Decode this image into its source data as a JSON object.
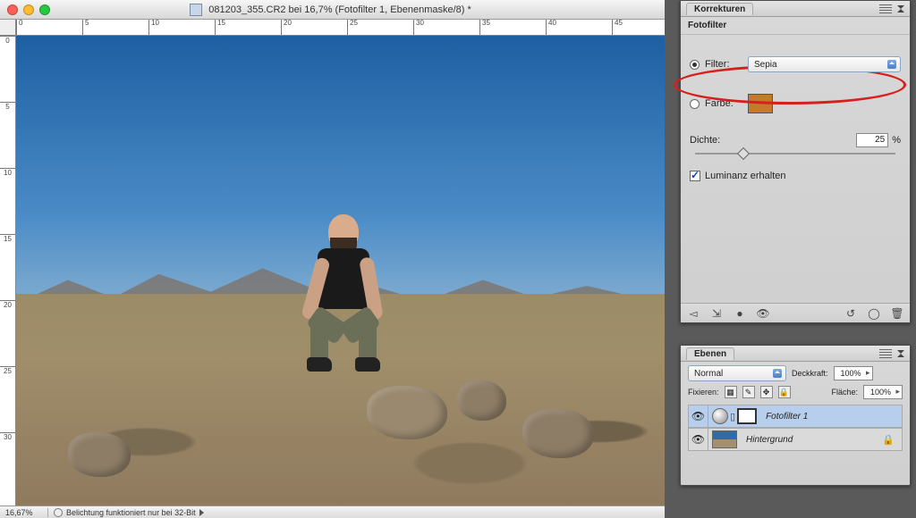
{
  "window": {
    "title": "081203_355.CR2 bei 16,7% (Fotofilter 1, Ebenenmaske/8) *"
  },
  "status": {
    "zoom": "16,67%",
    "info": "Belichtung funktioniert nur bei 32-Bit"
  },
  "ruler_h": [
    "0",
    "5",
    "10",
    "15",
    "20",
    "25",
    "30",
    "35",
    "40",
    "45"
  ],
  "ruler_v": [
    "0",
    "5",
    "10",
    "15",
    "20",
    "25",
    "30"
  ],
  "korrekturen": {
    "panel_title": "Korrekturen",
    "subtitle": "Fotofilter",
    "filter_label": "Filter:",
    "filter_value": "Sepia",
    "farbe_label": "Farbe:",
    "farbe_swatch": "#c47a2a",
    "dichte_label": "Dichte:",
    "dichte_value": "25",
    "dichte_pct": "%",
    "luminanz_label": "Luminanz erhalten",
    "mode": "filter"
  },
  "ebenen": {
    "panel_title": "Ebenen",
    "blend_mode": "Normal",
    "deckkraft_label": "Deckkraft:",
    "deckkraft_value": "100%",
    "fixieren_label": "Fixieren:",
    "flaeche_label": "Fläche:",
    "flaeche_value": "100%",
    "layers": [
      {
        "name": "Fotofilter 1",
        "type": "adjustment",
        "active": true
      },
      {
        "name": "Hintergrund",
        "type": "background",
        "locked": true
      }
    ]
  }
}
